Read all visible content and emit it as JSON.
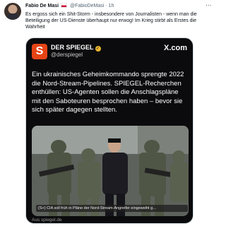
{
  "tweet": {
    "author_name": "Fabio De Masi",
    "author_handle": "@FabioDeMasi",
    "time": "1h",
    "more": "···",
    "text": "Es ergoss sich ein Shit-Storm - insbesondere von Journalisten - wenn man die Beteiligung der US-Dienste überhaupt nur erwog! Im Krieg stirbt als Erstes die Wahrheit"
  },
  "card": {
    "logo_letter": "S",
    "account_name": "DER SPIEGEL",
    "verified_mark": "✓",
    "account_handle": "@derspiegel",
    "platform": "X.com",
    "text": "Ein ukrainisches Geheimkommando sprengte 2022 die Nord-Stream-Pipelines. SPIEGEL-Recherchen enthüllen: US-Agenten sollen die Anschlagspläne mit den Saboteuren besprochen haben – bevor sie sich später dagegen stellten.",
    "photo_caption": "(S+) CIA soll früh in Pläne der Nord-Stream-Angreifer eingeweiht g…",
    "source": "Aus spiegel.de"
  },
  "colors": {
    "spiegel_orange": "#e64415",
    "card_background": "#0b0b0d",
    "text_primary": "#0f1419",
    "text_secondary": "#536471"
  }
}
